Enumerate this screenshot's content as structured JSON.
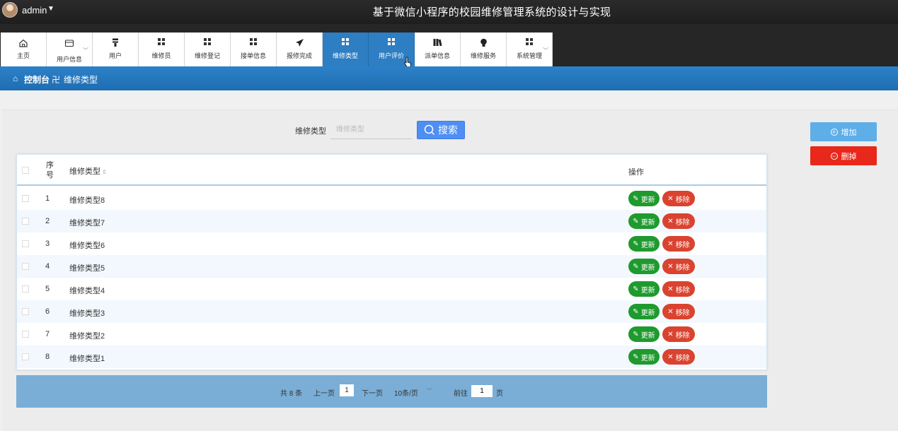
{
  "header": {
    "user": "admin",
    "site_title": "基于微信小程序的校园维修管理系统的设计与实现"
  },
  "nav": {
    "items": [
      {
        "label": "主页",
        "icon": "home-icon"
      },
      {
        "label": "用户信息",
        "icon": "card-icon"
      },
      {
        "label": "用户",
        "icon": "user-icon"
      },
      {
        "label": "维修员",
        "icon": "grid-icon"
      },
      {
        "label": "维修登记",
        "icon": "grid-icon"
      },
      {
        "label": "接单信息",
        "icon": "grid-icon"
      },
      {
        "label": "报修完成",
        "icon": "send-icon"
      },
      {
        "label": "维修类型",
        "icon": "grid-icon"
      },
      {
        "label": "用户评价",
        "icon": "grid-icon"
      },
      {
        "label": "派单信息",
        "icon": "book-icon"
      },
      {
        "label": "维修服务",
        "icon": "bulb-icon"
      },
      {
        "label": "系统管理",
        "icon": "grid-icon"
      }
    ],
    "active": "维修类型"
  },
  "breadcrumb": {
    "root": "控制台",
    "current": "维修类型"
  },
  "search": {
    "label": "维修类型",
    "placeholder": "维修类型",
    "button": "搜索"
  },
  "actions": {
    "add": "增加",
    "delete": "删掉"
  },
  "table": {
    "headers": {
      "index": "序号",
      "type": "维修类型",
      "ops": "操作"
    },
    "edit_label": "更新",
    "remove_label": "移除",
    "rows": [
      {
        "index": "1",
        "name": "维修类型8"
      },
      {
        "index": "2",
        "name": "维修类型7"
      },
      {
        "index": "3",
        "name": "维修类型6"
      },
      {
        "index": "4",
        "name": "维修类型5"
      },
      {
        "index": "5",
        "name": "维修类型4"
      },
      {
        "index": "6",
        "name": "维修类型3"
      },
      {
        "index": "7",
        "name": "维修类型2"
      },
      {
        "index": "8",
        "name": "维修类型1"
      }
    ]
  },
  "pagination": {
    "total": "共 8 条",
    "prev": "上一页",
    "current_page": "1",
    "next": "下一页",
    "page_size": "10条/页",
    "goto": "前往",
    "goto_value": "1",
    "page_suffix": "页"
  },
  "colors": {
    "header_bg": "#1e1e1e",
    "active_tab": "#2d7ec3",
    "breadcrumb_bg": "#2478bf",
    "edit_button": "#1f9a2e",
    "remove_button": "#d9432f",
    "add_button": "#5eaee8",
    "delete_button": "#e8281a",
    "pager_bg": "#7aaed6"
  }
}
